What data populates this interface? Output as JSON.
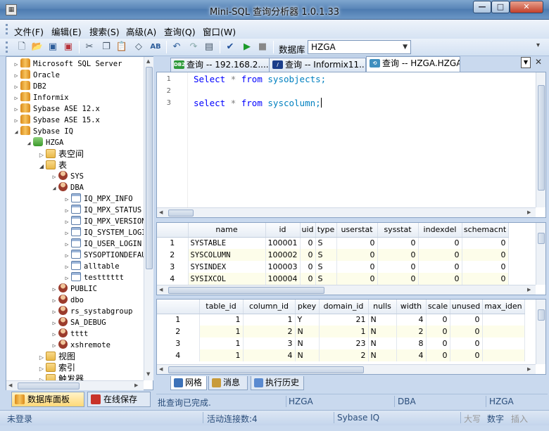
{
  "window": {
    "title": "Mini-SQL 查询分析器 1.0.1.33",
    "controls": {
      "minimize": "—",
      "maximize": "□",
      "close": "✕"
    }
  },
  "menu": [
    "文件(F)",
    "编辑(E)",
    "搜索(S)",
    "高级(A)",
    "查询(Q)",
    "窗口(W)"
  ],
  "toolbar": {
    "icons": [
      "new-icon",
      "open-icon",
      "save-icon",
      "save-all-icon",
      "cut-icon",
      "copy-icon",
      "paste-icon",
      "eraser-icon",
      "spellcheck-icon",
      "undo-icon",
      "redo-icon",
      "results-icon",
      "check-icon",
      "run-icon",
      "stop-icon"
    ],
    "database_label": "数据库",
    "database_value": "HZGA"
  },
  "tree": [
    {
      "level": 0,
      "toggle": "▷",
      "icon": "cyl",
      "label": "Microsoft SQL Server"
    },
    {
      "level": 0,
      "toggle": "▷",
      "icon": "cyl",
      "label": "Oracle"
    },
    {
      "level": 0,
      "toggle": "▷",
      "icon": "cyl",
      "label": "DB2"
    },
    {
      "level": 0,
      "toggle": "▷",
      "icon": "cyl",
      "label": "Informix"
    },
    {
      "level": 0,
      "toggle": "▷",
      "icon": "cyl",
      "label": "Sybase ASE 12.x"
    },
    {
      "level": 0,
      "toggle": "▷",
      "icon": "cyl",
      "label": "Sybase ASE 15.x"
    },
    {
      "level": 0,
      "toggle": "◢",
      "icon": "cyl",
      "label": "Sybase IQ"
    },
    {
      "level": 1,
      "toggle": "◢",
      "icon": "db",
      "label": "HZGA"
    },
    {
      "level": 2,
      "toggle": "▷",
      "icon": "folder",
      "label": "表空间",
      "cjk": true
    },
    {
      "level": 2,
      "toggle": "◢",
      "icon": "folder",
      "label": "表",
      "cjk": true
    },
    {
      "level": 3,
      "toggle": "▷",
      "icon": "user",
      "label": "SYS"
    },
    {
      "level": 3,
      "toggle": "◢",
      "icon": "user",
      "label": "DBA"
    },
    {
      "level": 4,
      "toggle": "▷",
      "icon": "table",
      "label": "IQ_MPX_INFO"
    },
    {
      "level": 4,
      "toggle": "▷",
      "icon": "table",
      "label": "IQ_MPX_STATUS"
    },
    {
      "level": 4,
      "toggle": "▷",
      "icon": "table",
      "label": "IQ_MPX_VERSION"
    },
    {
      "level": 4,
      "toggle": "▷",
      "icon": "table",
      "label": "IQ_SYSTEM_LOGIN"
    },
    {
      "level": 4,
      "toggle": "▷",
      "icon": "table",
      "label": "IQ_USER_LOGIN"
    },
    {
      "level": 4,
      "toggle": "▷",
      "icon": "table",
      "label": "SYSOPTIONDEFAULTS"
    },
    {
      "level": 4,
      "toggle": "▷",
      "icon": "table",
      "label": "alltable"
    },
    {
      "level": 4,
      "toggle": "▷",
      "icon": "table",
      "label": "testttttt"
    },
    {
      "level": 3,
      "toggle": "▷",
      "icon": "user",
      "label": "PUBLIC"
    },
    {
      "level": 3,
      "toggle": "▷",
      "icon": "user",
      "label": "dbo"
    },
    {
      "level": 3,
      "toggle": "▷",
      "icon": "user",
      "label": "rs_systabgroup"
    },
    {
      "level": 3,
      "toggle": "▷",
      "icon": "user",
      "label": "SA_DEBUG"
    },
    {
      "level": 3,
      "toggle": "▷",
      "icon": "user",
      "label": "tttt"
    },
    {
      "level": 3,
      "toggle": "▷",
      "icon": "user",
      "label": "xshremote"
    },
    {
      "level": 2,
      "toggle": "▷",
      "icon": "folder",
      "label": "视图",
      "cjk": true
    },
    {
      "level": 2,
      "toggle": "▷",
      "icon": "folder",
      "label": "索引",
      "cjk": true
    },
    {
      "level": 2,
      "toggle": "▷",
      "icon": "folder",
      "label": "触发器",
      "cjk": true
    }
  ],
  "left_tabs": {
    "database_panel": "数据库面板",
    "online_save": "在线保存"
  },
  "editor_tabs": [
    {
      "badge": "DB2",
      "badge_color": "#2e9a3a",
      "label": "查询 -- 192.168.2...."
    },
    {
      "badge": "/",
      "badge_color": "#1b3e8a",
      "label": "查询 -- Informix11...."
    },
    {
      "badge": "⟲",
      "badge_color": "#3f8fbf",
      "label": "查询 -- HZGA.HZGA...."
    }
  ],
  "editor": {
    "line_numbers": [
      "1",
      "2",
      "3"
    ],
    "line1": {
      "kw1": "Select",
      "op": "*",
      "kw2": "from",
      "id": "sysobjects;"
    },
    "line3": {
      "kw1": "select",
      "op": "*",
      "kw2": "from",
      "id": "syscolumn;"
    }
  },
  "grid1": {
    "columns": [
      "",
      "name",
      "id",
      "uid",
      "type",
      "userstat",
      "sysstat",
      "indexdel",
      "schemacnt"
    ],
    "rows": [
      [
        "1",
        "SYSTABLE",
        "100001",
        "0",
        "S",
        "0",
        "0",
        "0",
        "0"
      ],
      [
        "2",
        "SYSCOLUMN",
        "100002",
        "0",
        "S",
        "0",
        "0",
        "0",
        "0"
      ],
      [
        "3",
        "SYSINDEX",
        "100003",
        "0",
        "S",
        "0",
        "0",
        "0",
        "0"
      ],
      [
        "4",
        "SYSIXCOL",
        "100004",
        "0",
        "S",
        "0",
        "0",
        "0",
        "0"
      ]
    ]
  },
  "grid2": {
    "columns": [
      "",
      "table_id",
      "column_id",
      "pkey",
      "domain_id",
      "nulls",
      "width",
      "scale",
      "unused",
      "max_iden"
    ],
    "rows": [
      [
        "1",
        "1",
        "1",
        "Y",
        "21",
        "N",
        "4",
        "0",
        "0",
        ""
      ],
      [
        "2",
        "1",
        "2",
        "N",
        "1",
        "N",
        "2",
        "0",
        "0",
        ""
      ],
      [
        "3",
        "1",
        "3",
        "N",
        "23",
        "N",
        "8",
        "0",
        "0",
        ""
      ],
      [
        "4",
        "1",
        "4",
        "N",
        "2",
        "N",
        "4",
        "0",
        "0",
        ""
      ]
    ]
  },
  "result_tabs": {
    "grid": "网格",
    "messages": "消息",
    "history": "执行历史"
  },
  "status_top": {
    "message": "批查询已完成.",
    "db1": "HZGA",
    "user": "DBA",
    "db2": "HZGA"
  },
  "status_bottom": {
    "login": "未登录",
    "connections": "活动连接数:4",
    "dbtype": "Sybase IQ",
    "caps": "大写",
    "num": "数字",
    "insert": "插入"
  }
}
